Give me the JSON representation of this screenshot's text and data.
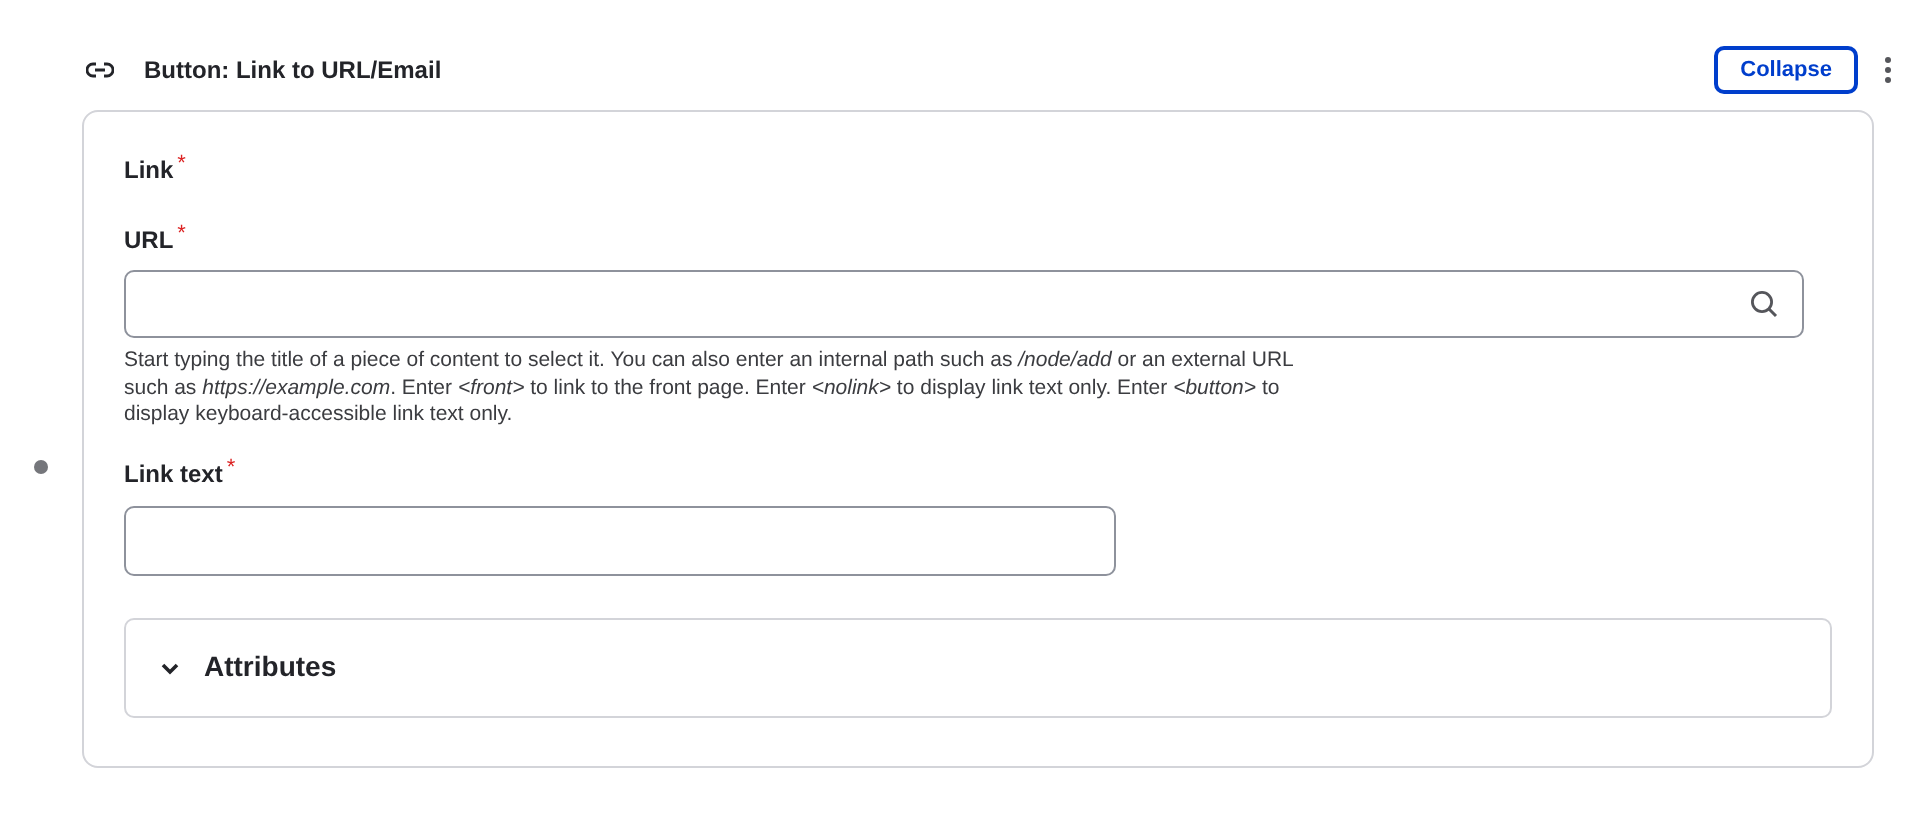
{
  "header": {
    "title": "Button: Link to URL/Email",
    "collapse_button": "Collapse"
  },
  "section_label": {
    "text": "Link",
    "required_mark": "*"
  },
  "url_field": {
    "label": "URL",
    "required_mark": "*",
    "description": "Start typing the title of a piece of content to select it. You can also enter an internal path such as */node/add* or an external URL such as *https://example.com*. Enter *<front>* to link to the front page. Enter *<nolink>* to display link text only. Enter *<button>* to display keyboard-accessible link text only."
  },
  "link_text_field": {
    "label": "Link text",
    "required_mark": "*"
  },
  "attributes": {
    "label": "Attributes",
    "expanded": false
  }
}
